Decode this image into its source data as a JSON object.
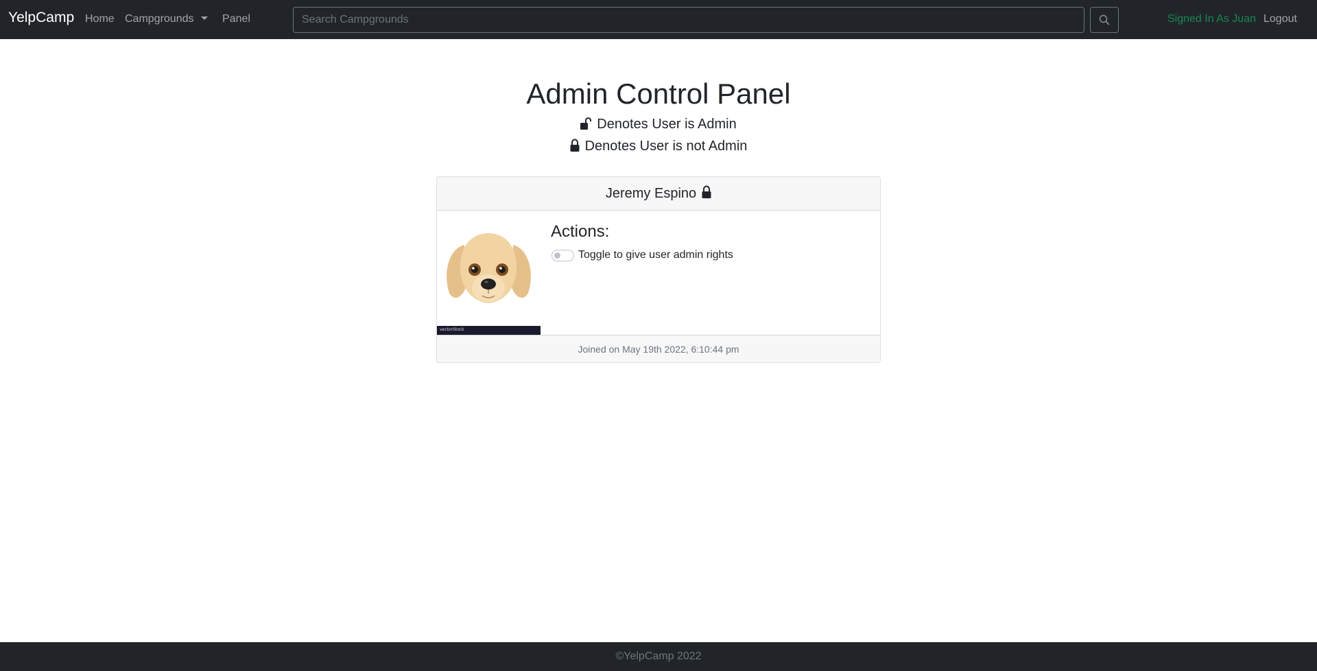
{
  "navbar": {
    "brand": "YelpCamp",
    "links": {
      "home": "Home",
      "campgrounds": "Campgrounds",
      "panel": "Panel"
    },
    "search": {
      "placeholder": "Search Campgrounds",
      "value": ""
    },
    "signed_in": "Signed In As Juan",
    "logout": "Logout"
  },
  "main": {
    "title": "Admin Control Panel",
    "legend": {
      "admin": "Denotes User is Admin",
      "not_admin": "Denotes User is not Admin"
    }
  },
  "user_card": {
    "name": "Jeremy Espino",
    "is_admin": false,
    "avatar_caption": "vectorStock",
    "actions_title": "Actions:",
    "toggle_label": "Toggle to give user admin rights",
    "joined": "Joined on May 19th 2022, 6:10:44 pm"
  },
  "footer": {
    "text": "©YelpCamp 2022"
  },
  "colors": {
    "navbar_bg": "#212529",
    "signed_in": "#198754",
    "card_header_bg": "#f7f7f7"
  },
  "icons": {
    "search": "search-icon",
    "unlocked": "unlock-icon",
    "locked": "lock-icon",
    "caret": "chevron-down-icon"
  }
}
